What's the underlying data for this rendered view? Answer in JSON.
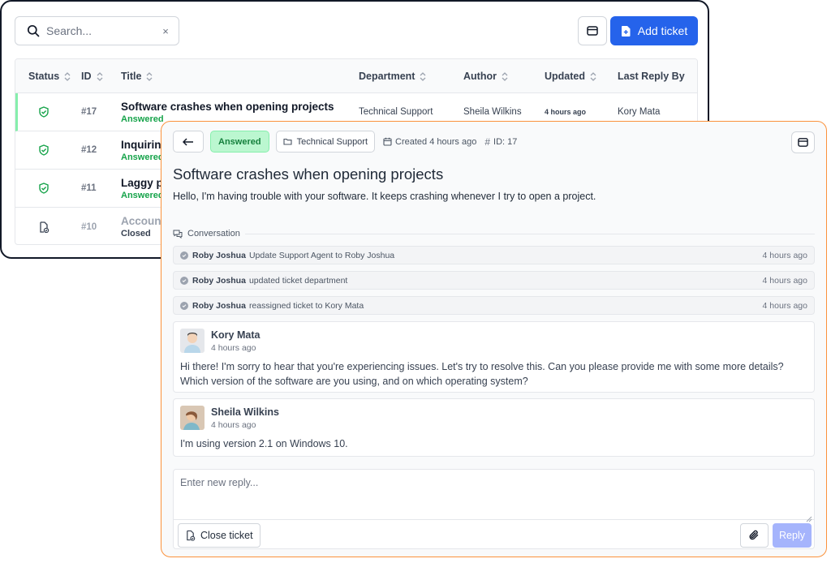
{
  "list": {
    "search": {
      "placeholder": "Search...",
      "clear": "×"
    },
    "add_ticket_label": "Add ticket",
    "columns": {
      "status": "Status",
      "id": "ID",
      "title": "Title",
      "department": "Department",
      "author": "Author",
      "updated": "Updated",
      "last_reply_by": "Last Reply By"
    },
    "rows": [
      {
        "status_icon": "shield-check-icon",
        "id": "#17",
        "title": "Software crashes when opening projects",
        "status": "Answered",
        "department": "Technical Support",
        "author": "Sheila Wilkins",
        "updated": "4 hours ago",
        "last_reply_by": "Kory Mata"
      },
      {
        "status_icon": "shield-check-icon",
        "id": "#12",
        "title": "Inquiring",
        "status": "Answered"
      },
      {
        "status_icon": "shield-check-icon",
        "id": "#11",
        "title": "Laggy pe",
        "status": "Answered"
      },
      {
        "status_icon": "document-check-icon",
        "id": "#10",
        "title": "Account",
        "status": "Closed"
      }
    ]
  },
  "detail": {
    "status_badge": "Answered",
    "department": "Technical Support",
    "created": "Created 4 hours ago",
    "ticket_id": "ID: 17",
    "title": "Software crashes when opening projects",
    "description": "Hello, I'm having trouble with your software. It keeps crashing whenever I try to open a project.",
    "conversation_label": "Conversation",
    "events": [
      {
        "who": "Roby Joshua",
        "text": "Update Support Agent to Roby Joshua",
        "when": "4 hours ago"
      },
      {
        "who": "Roby Joshua",
        "text": "updated ticket department",
        "when": "4 hours ago"
      },
      {
        "who": "Roby Joshua",
        "text": "reassigned ticket to Kory Mata",
        "when": "4 hours ago"
      }
    ],
    "messages": [
      {
        "author": "Kory Mata",
        "time": "4 hours ago",
        "body": "Hi there! I'm sorry to hear that you're experiencing issues. Let's try to resolve this. Can you please provide me with some more details? Which version of the software are you using, and on which operating system?"
      },
      {
        "author": "Sheila Wilkins",
        "time": "4 hours ago",
        "body": "I'm using version 2.1 on Windows 10."
      }
    ],
    "reply_placeholder": "Enter new reply...",
    "close_ticket_label": "Close ticket",
    "reply_label": "Reply"
  },
  "colors": {
    "primary": "#2563eb",
    "answered": "#16a34a",
    "accent_border": "#fb923c",
    "reply_disabled": "#a5b4fc"
  }
}
